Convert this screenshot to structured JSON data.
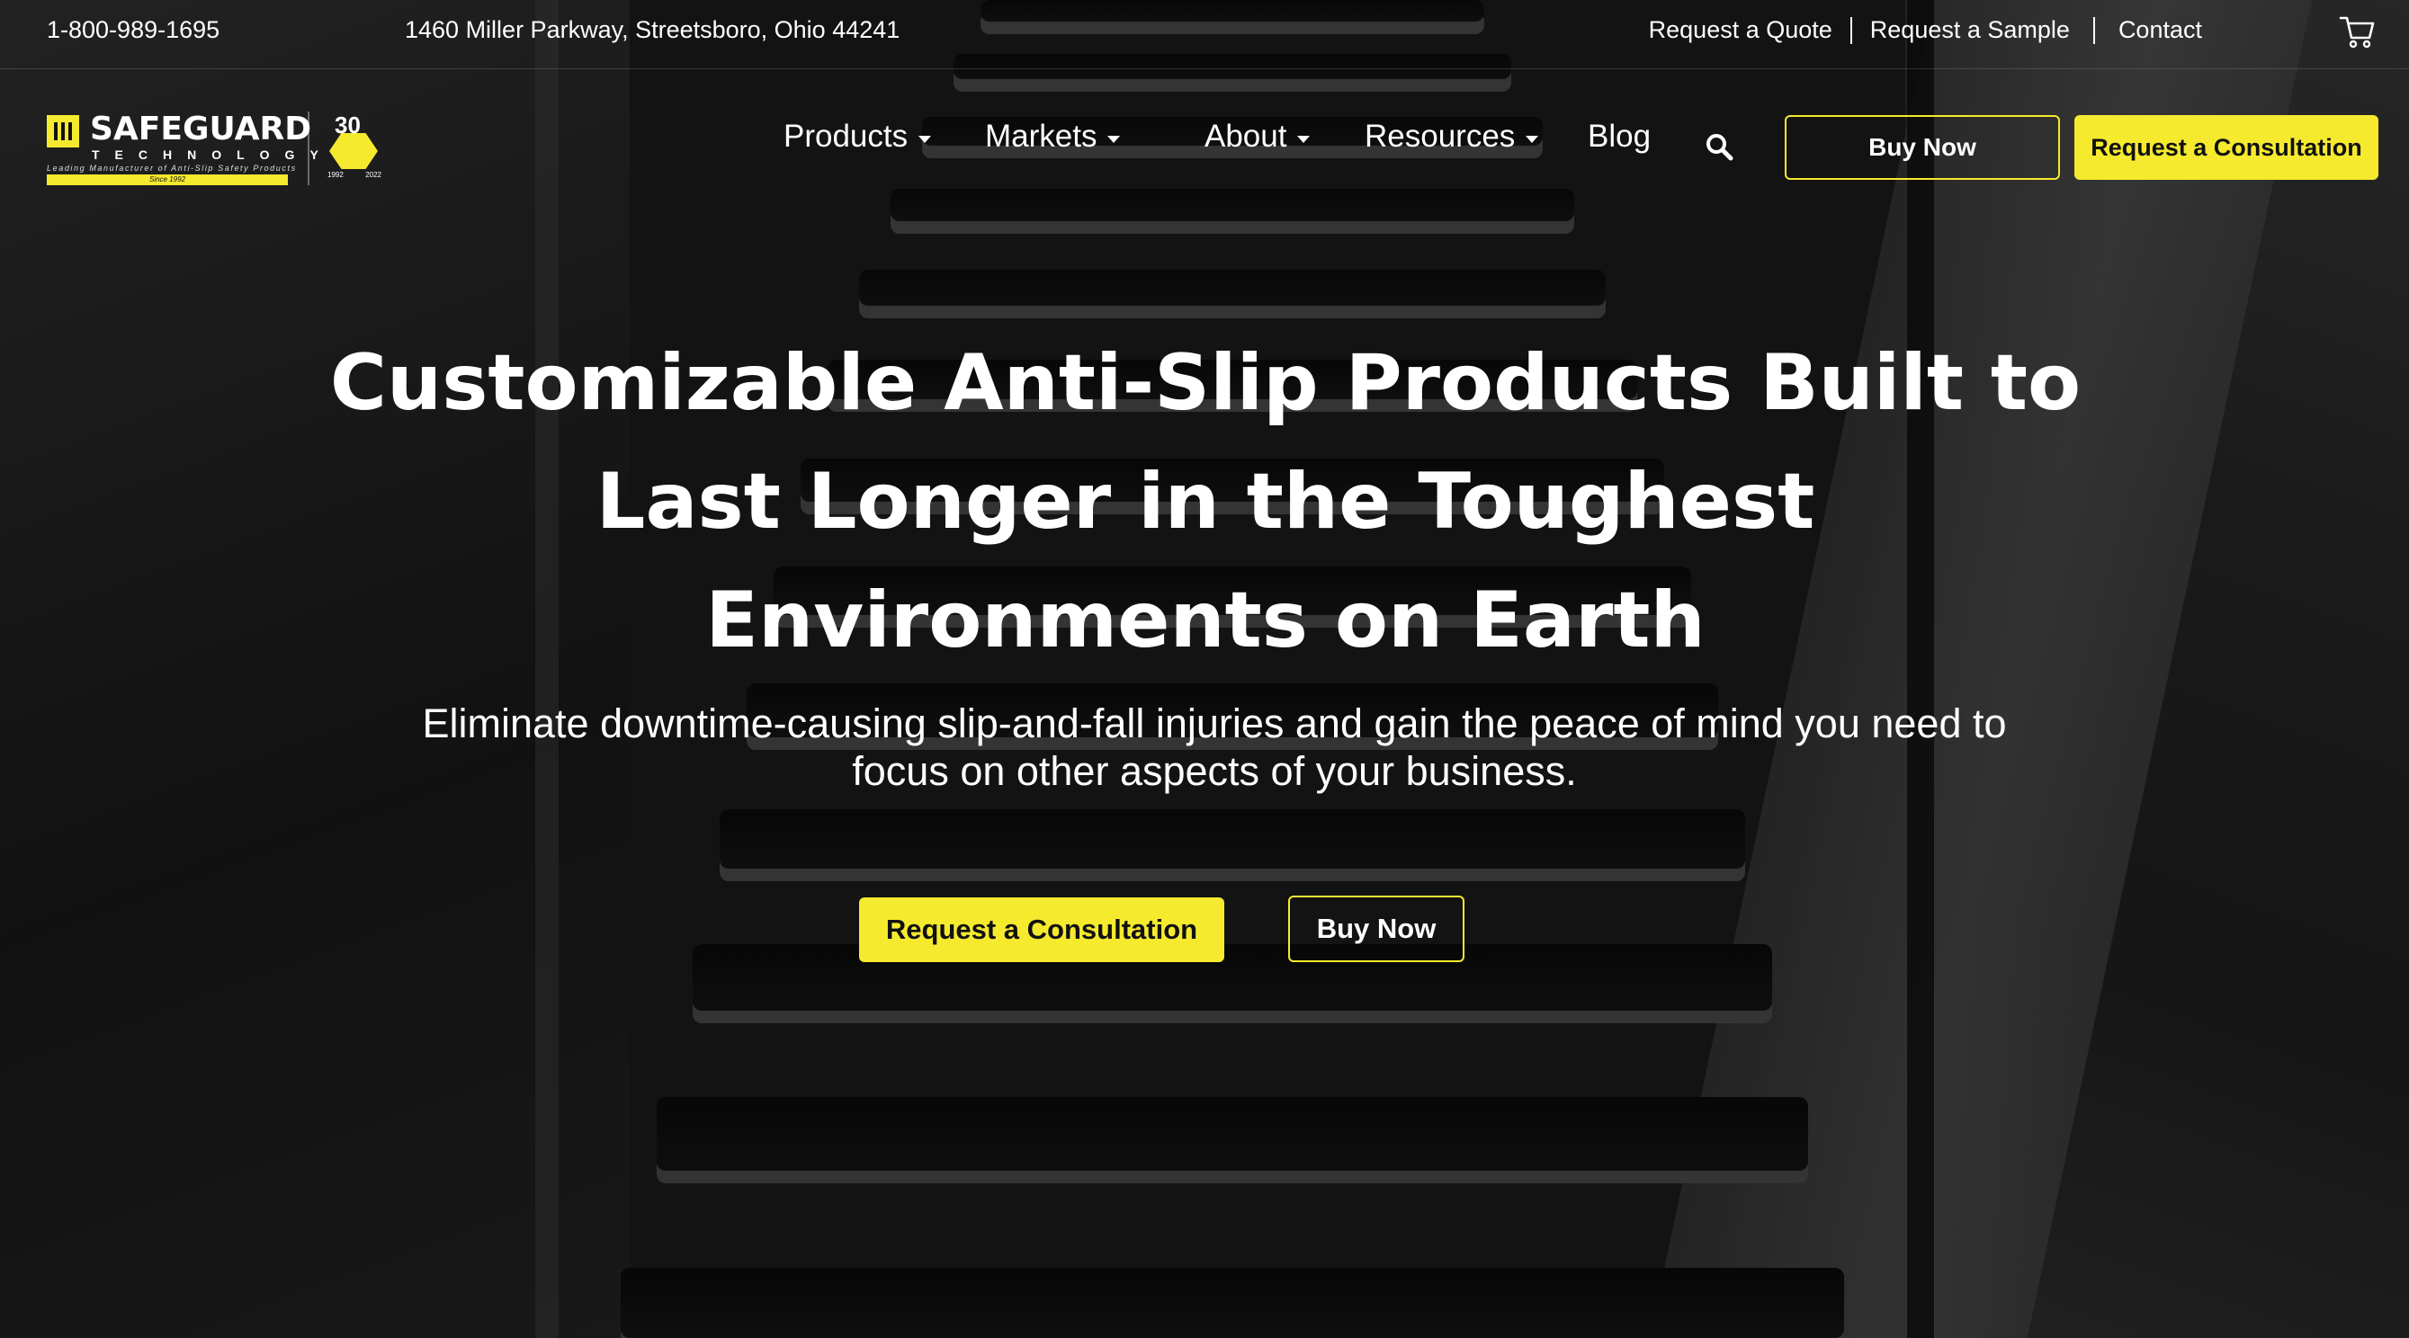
{
  "topbar": {
    "phone": "1-800-989-1695",
    "address": "1460 Miller Parkway, Streetsboro, Ohio 44241",
    "links": [
      "Request a Quote",
      "Request a Sample",
      "Contact"
    ],
    "cart_icon": "cart-icon"
  },
  "logo": {
    "name": "SAFEGUARD",
    "sub": "TECHNOLOGY",
    "tagline": "Leading Manufacturer of Anti-Slip Safety Products",
    "since": "Since 1992",
    "badge_number": "30",
    "badge_start": "1992",
    "badge_end": "2022"
  },
  "nav": {
    "items": [
      {
        "label": "Products",
        "has_dropdown": true
      },
      {
        "label": "Markets",
        "has_dropdown": true
      },
      {
        "label": "About",
        "has_dropdown": true
      },
      {
        "label": "Resources",
        "has_dropdown": true
      },
      {
        "label": "Blog",
        "has_dropdown": false
      }
    ],
    "search_icon": "search-icon",
    "buy_now": "Buy Now",
    "consultation": "Request a Consultation"
  },
  "hero": {
    "headline": "Customizable Anti-Slip Products Built to Last Longer in the Toughest Environments on Earth",
    "subhead": "Eliminate downtime-causing slip-and-fall injuries and gain the peace of mind you need to focus on other aspects of your business.",
    "primary_button": "Request a Consultation",
    "secondary_button": "Buy Now"
  },
  "colors": {
    "accent": "#f6ea2e",
    "text": "#ffffff",
    "button_text_dark": "#111111"
  }
}
